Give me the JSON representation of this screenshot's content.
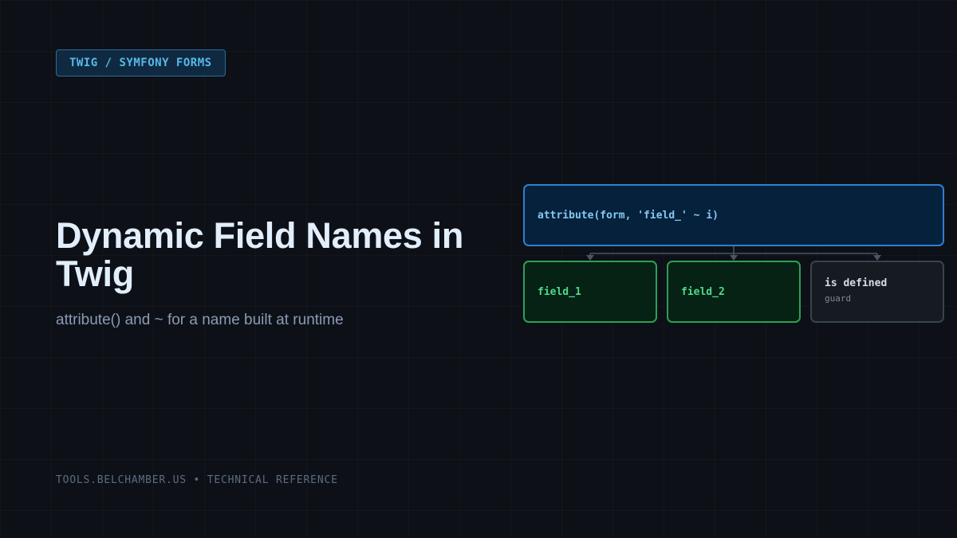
{
  "tag": {
    "label": "TWIG / SYMFONY FORMS"
  },
  "heading": {
    "title": "Dynamic Field Names in Twig",
    "subtitle": "attribute() and ~ for a name built at runtime"
  },
  "diagram": {
    "root": {
      "label": "attribute(form, 'field_' ~ i)"
    },
    "children": [
      {
        "label": "field_1"
      },
      {
        "label": "field_2"
      },
      {
        "label": "is defined",
        "sublabel": "guard"
      }
    ]
  },
  "footer": {
    "text": "TOOLS.BELCHAMBER.US • TECHNICAL REFERENCE"
  },
  "colors": {
    "background": "#0d1117",
    "accent_blue": "#2f7fd0",
    "accent_green": "#2f9e57",
    "neutral": "#39434f"
  }
}
